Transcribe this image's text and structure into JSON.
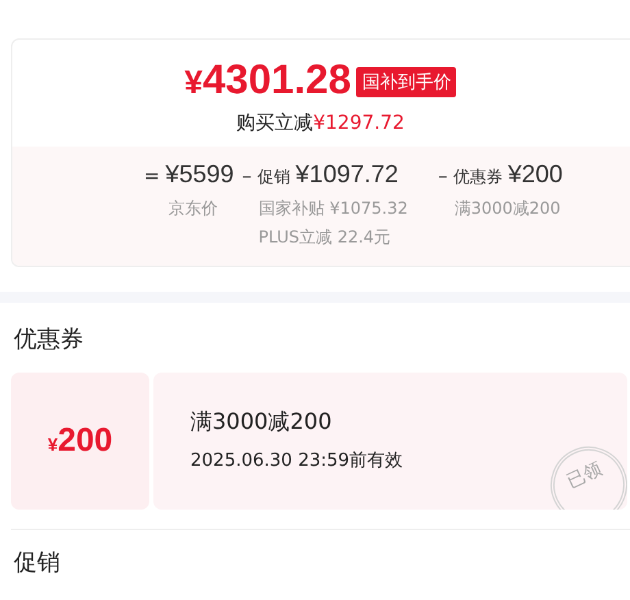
{
  "price": {
    "currency": "¥",
    "amount": "4301.28",
    "badge": "国补到手价",
    "saving_label": "购买立减",
    "saving_amount": "¥1297.72"
  },
  "breakdown": [
    {
      "op": "=",
      "amount": "¥5599",
      "notes": [
        "京东价"
      ]
    },
    {
      "op": "–",
      "label": "促销",
      "amount": "¥1097.72",
      "notes": [
        "国家补贴 ¥1075.32",
        "PLUS立减 22.4元"
      ]
    },
    {
      "op": "–",
      "label": "优惠券",
      "amount": "¥200",
      "notes": [
        "满3000减200"
      ]
    }
  ],
  "coupon_section": {
    "title": "优惠券",
    "coupons": [
      {
        "currency": "¥",
        "value": "200",
        "title": "满3000减200",
        "validity": "2025.06.30 23:59前有效",
        "stamp": "已领"
      }
    ]
  },
  "promo_section": {
    "title": "促销"
  }
}
